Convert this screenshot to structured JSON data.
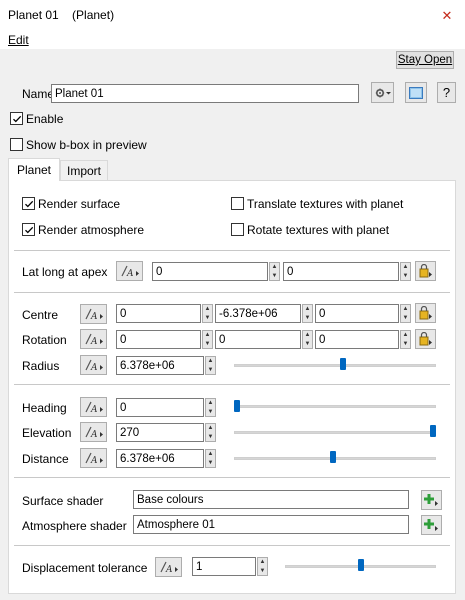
{
  "window": {
    "title": "Planet 01    (Planet)",
    "close_glyph": "✕"
  },
  "menu": {
    "edit_label": "Edit"
  },
  "toolbar": {
    "stay_open_label": "Stay Open",
    "help_label": "?"
  },
  "name_row": {
    "label": "Name",
    "value": "Planet 01"
  },
  "enable": {
    "label": "Enable",
    "checked": true
  },
  "show_bbox": {
    "label": "Show b-box in preview",
    "checked": false
  },
  "tabs": [
    {
      "label": "Planet",
      "active": true
    },
    {
      "label": "Import",
      "active": false
    }
  ],
  "planet": {
    "render_surface": {
      "label": "Render surface",
      "checked": true
    },
    "render_atmosphere": {
      "label": "Render atmosphere",
      "checked": true
    },
    "translate_textures": {
      "label": "Translate textures with planet",
      "checked": false
    },
    "rotate_textures": {
      "label": "Rotate textures with planet",
      "checked": false
    },
    "lat_long": {
      "label": "Lat long at apex",
      "lat": "0",
      "long": "0"
    },
    "centre": {
      "label": "Centre",
      "x": "0",
      "y": "-6.378e+06",
      "z": "0"
    },
    "rotation": {
      "label": "Rotation",
      "x": "0",
      "y": "0",
      "z": "0"
    },
    "radius": {
      "label": "Radius",
      "value": "6.378e+06",
      "slider": 0.54
    },
    "heading": {
      "label": "Heading",
      "value": "0",
      "slider": 0.0
    },
    "elevation": {
      "label": "Elevation",
      "value": "270",
      "slider": 1.0
    },
    "distance": {
      "label": "Distance",
      "value": "6.378e+06",
      "slider": 0.49
    },
    "surface_shader": {
      "label": "Surface shader",
      "value": "Base colours"
    },
    "atmosphere_shader": {
      "label": "Atmosphere shader",
      "value": "Atmosphere 01"
    },
    "displacement_tolerance": {
      "label": "Displacement tolerance",
      "value": "1",
      "slider": 0.5
    }
  },
  "colors": {
    "accent": "#0067c0",
    "close": "#c42b1c",
    "plus_green": "#2e9e3a",
    "lock_yellow": "#e6b422"
  }
}
